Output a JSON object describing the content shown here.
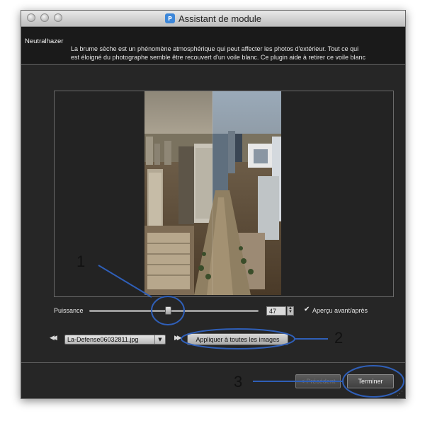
{
  "window": {
    "title": "Assistant de module",
    "app_icon": "plugin-app-icon"
  },
  "header": {
    "plugin_name": "Neutralhazer",
    "description_line1": "La brume sèche est un phénomène atmosphérique qui peut affecter les photos d'extérieur. Tout ce qui",
    "description_line2": "est éloigné du photographe semble être recouvert d'un voile blanc. Ce plugin aide à retirer ce voile blanc"
  },
  "controls": {
    "strength_label": "Puissance",
    "strength_value": "47",
    "strength_fraction": 0.47,
    "preview_checkbox_label": "Aperçu avant/après",
    "preview_checked": true
  },
  "file_nav": {
    "filename": "La-Defense06032811.jpg",
    "apply_all_label": "Appliquer à toutes les images",
    "prev_icon": "rewind-icon",
    "next_icon": "fast-forward-icon"
  },
  "footer": {
    "previous_label": "< Précédent",
    "finish_label": "Terminer"
  },
  "callouts": [
    "1",
    "2",
    "3"
  ],
  "colors": {
    "annotation": "#2f5fb8",
    "window_bg": "#262626",
    "header_bg": "#1a1a1a"
  }
}
